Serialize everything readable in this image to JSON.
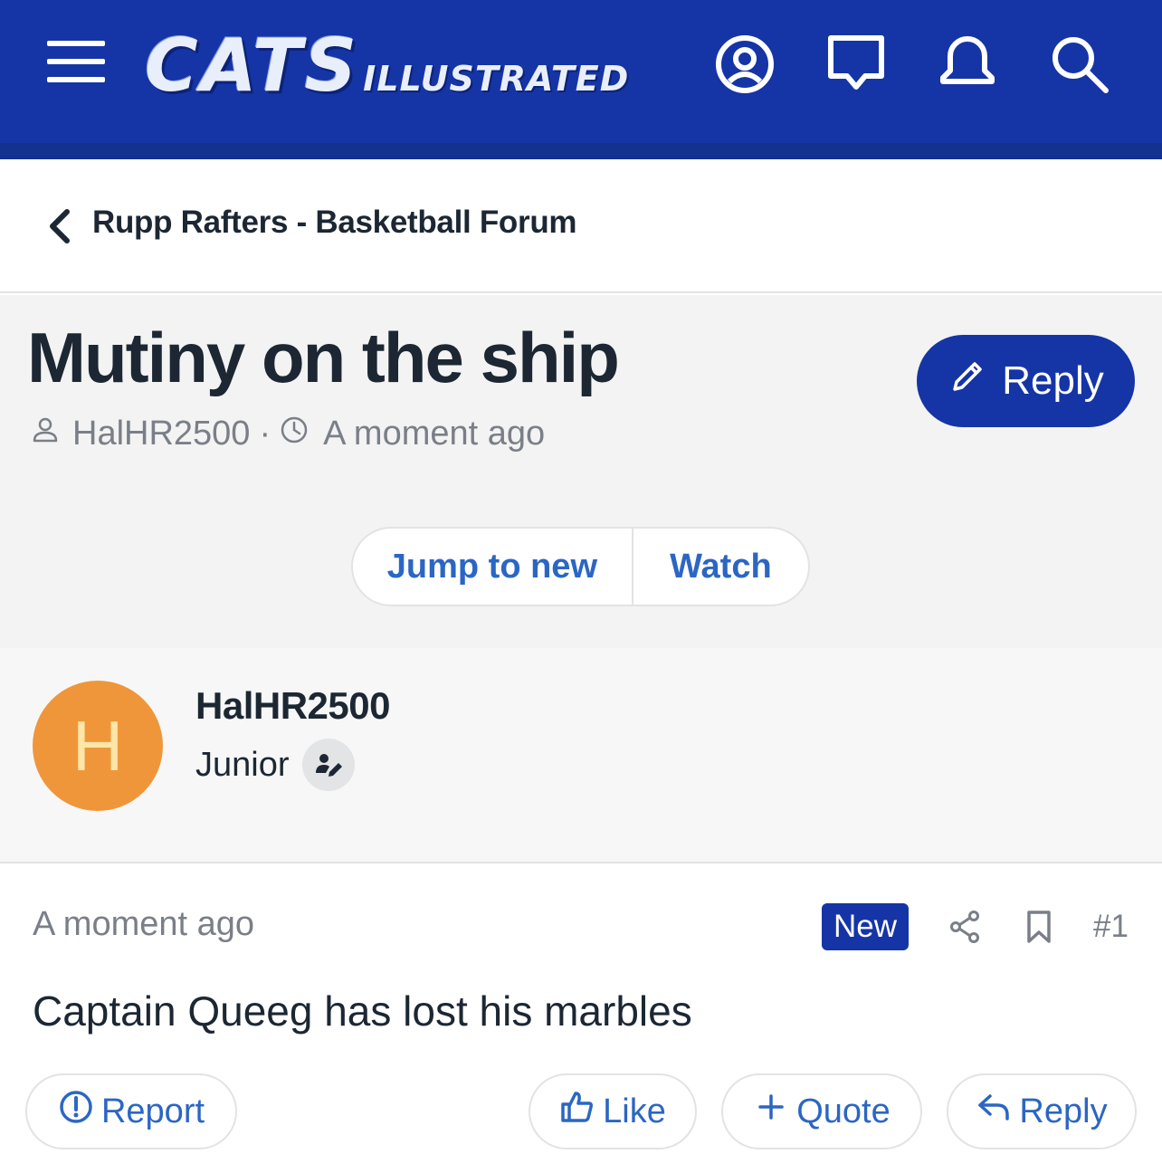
{
  "header": {
    "logo_main": "CATS",
    "logo_sub": "ILLUSTRATED",
    "icons": [
      "menu-icon",
      "account-icon",
      "conversations-icon",
      "alerts-icon",
      "search-icon"
    ],
    "brand_color": "#1535a6"
  },
  "breadcrumb": {
    "label": "Rupp Rafters - Basketball Forum"
  },
  "thread": {
    "title": "Mutiny on the ship",
    "author": "HalHR2500",
    "separator": "·",
    "time": "A moment ago",
    "reply_label": "Reply",
    "jump_label": "Jump to new",
    "watch_label": "Watch"
  },
  "post": {
    "avatar_letter": "H",
    "avatar_color": "#f0963a",
    "author": "HalHR2500",
    "rank": "Junior",
    "time": "A moment ago",
    "new_badge": "New",
    "number": "#1",
    "body": "Captain Queeg has lost his marbles",
    "actions": {
      "report": "Report",
      "like": "Like",
      "quote": "Quote",
      "reply": "Reply"
    }
  }
}
